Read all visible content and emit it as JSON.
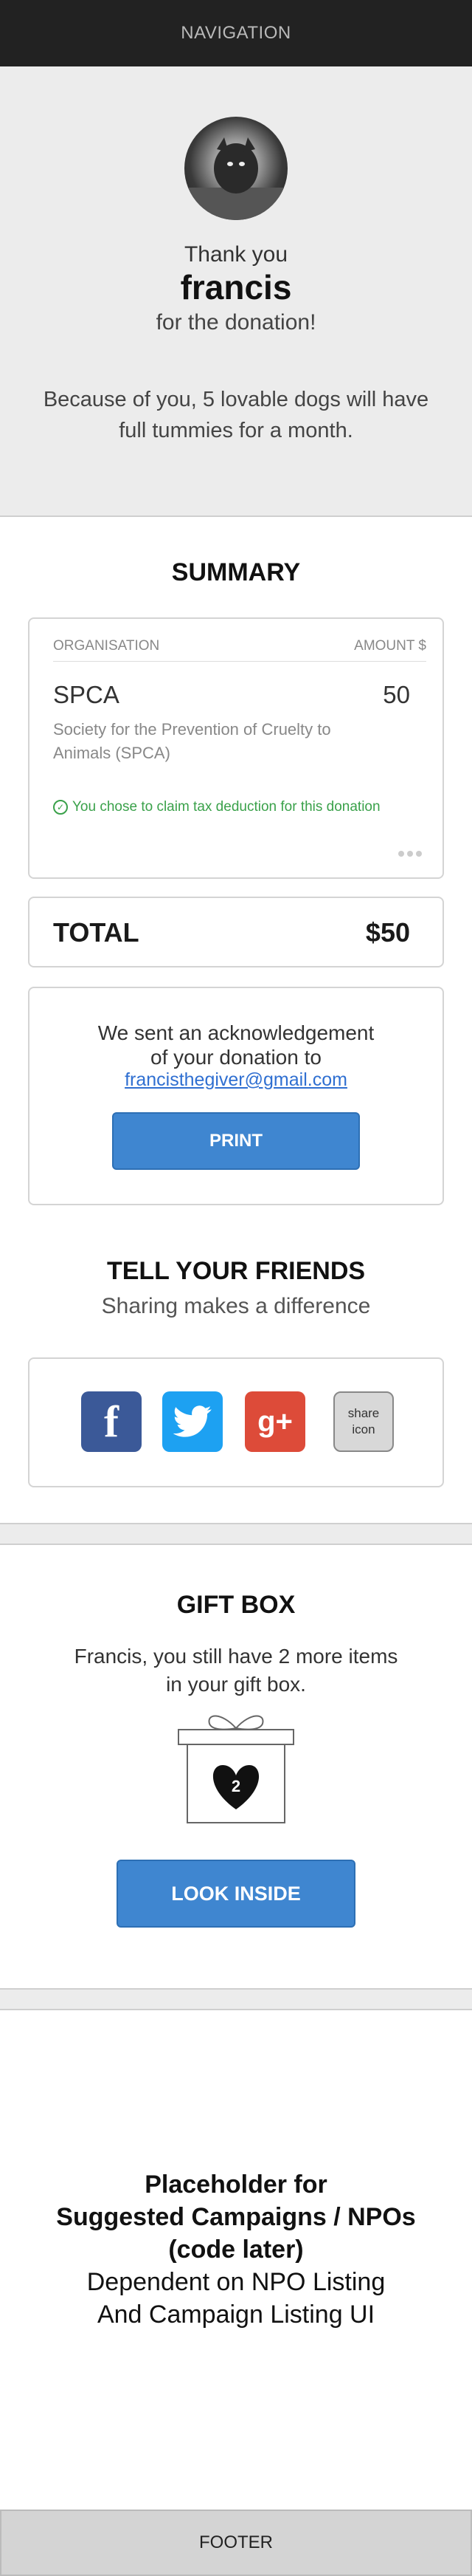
{
  "nav": {
    "label": "NAVIGATION"
  },
  "thanks": {
    "line1": "Thank you",
    "name": "francis",
    "line3": "for the donation!",
    "impact": "Because of you, 5 lovable dogs will have full tummies for a month."
  },
  "summary": {
    "title": "SUMMARY",
    "col_org": "ORGANISATION",
    "col_amount": "AMOUNT $",
    "org": "SPCA",
    "amount": "50",
    "org_desc": "Society for the Prevention of Cruelty to Animals (SPCA)",
    "tax_note": "You chose to claim tax deduction for this donation"
  },
  "total": {
    "label": "TOTAL",
    "value": "$50"
  },
  "ack": {
    "line1": "We sent an acknowledgement",
    "line2": "of your donation to",
    "email": "francisthegiver@gmail.com",
    "print_label": "PRINT"
  },
  "share": {
    "title": "TELL YOUR FRIENDS",
    "subtitle": "Sharing makes a difference",
    "placeholder_label": "share icon"
  },
  "gift": {
    "title": "GIFT BOX",
    "text": "Francis, you still have 2 more items in your gift box.",
    "count": "2",
    "button": "LOOK INSIDE"
  },
  "placeholder": {
    "line1": "Placeholder for",
    "line2": "Suggested Campaigns / NPOs",
    "line3": "(code later)",
    "line4": "Dependent on NPO Listing",
    "line5": "And Campaign Listing UI"
  },
  "footer": {
    "label": "FOOTER"
  },
  "colors": {
    "accent": "#3f86d0",
    "success": "#3aa14a",
    "facebook": "#3b5998",
    "twitter": "#1da1f2",
    "google_plus": "#dd4b39"
  }
}
